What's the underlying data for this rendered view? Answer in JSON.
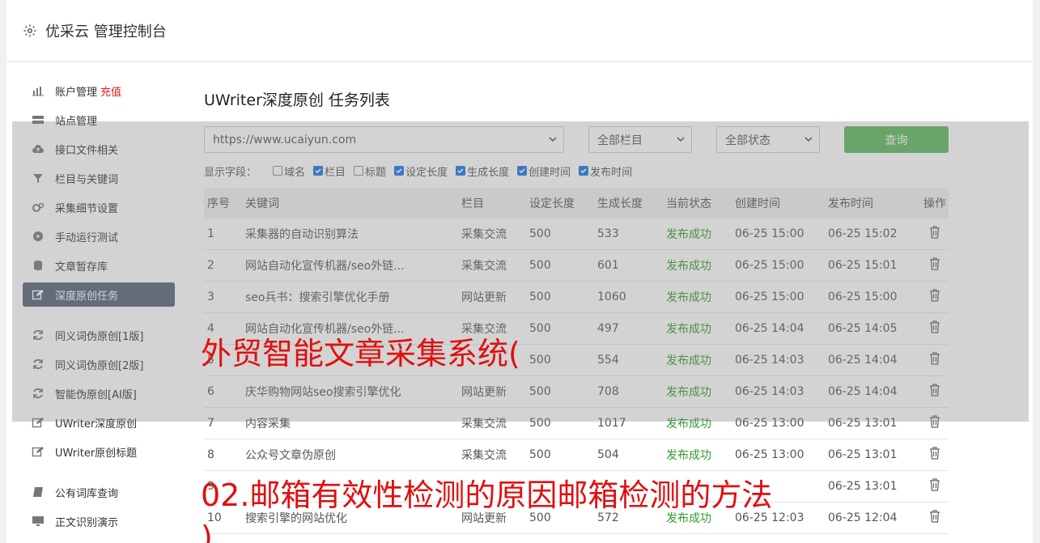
{
  "header": {
    "title": "优采云 管理控制台"
  },
  "sidebar": {
    "items": [
      {
        "label": "账户管理",
        "badge": "充值",
        "icon": "bar-chart-icon"
      },
      {
        "label": "站点管理",
        "icon": "server-icon"
      },
      {
        "label": "接口文件相关",
        "icon": "cloud-upload-icon"
      },
      {
        "label": "栏目与关键词",
        "icon": "filter-icon"
      },
      {
        "label": "采集细节设置",
        "icon": "cogs-icon"
      },
      {
        "label": "手动运行测试",
        "icon": "play-circle-icon"
      },
      {
        "label": "文章暂存库",
        "icon": "database-icon"
      },
      {
        "label": "深度原创任务",
        "icon": "edit-icon",
        "active": true
      },
      {
        "label": "同义词伪原创[1版]",
        "icon": "refresh-icon"
      },
      {
        "label": "同义词伪原创[2版]",
        "icon": "refresh-icon"
      },
      {
        "label": "智能伪原创[AI版]",
        "icon": "refresh-icon"
      },
      {
        "label": "UWriter深度原创",
        "icon": "edit-icon"
      },
      {
        "label": "UWriter原创标题",
        "icon": "edit-icon"
      },
      {
        "label": "公有词库查询",
        "icon": "book-icon"
      },
      {
        "label": "正文识别演示",
        "icon": "monitor-icon"
      }
    ]
  },
  "main": {
    "title": "UWriter深度原创 任务列表",
    "filters": {
      "site": "https://www.ucaiyun.com",
      "column": "全部栏目",
      "status": "全部状态",
      "query_label": "查询"
    },
    "fields": {
      "label": "显示字段：",
      "items": [
        {
          "label": "域名",
          "checked": false
        },
        {
          "label": "栏目",
          "checked": true
        },
        {
          "label": "标题",
          "checked": false
        },
        {
          "label": "设定长度",
          "checked": true
        },
        {
          "label": "生成长度",
          "checked": true
        },
        {
          "label": "创建时间",
          "checked": true
        },
        {
          "label": "发布时间",
          "checked": true
        }
      ]
    },
    "table": {
      "headers": [
        "序号",
        "关键词",
        "栏目",
        "设定长度",
        "生成长度",
        "当前状态",
        "创建时间",
        "发布时间",
        "操作"
      ],
      "rows": [
        [
          "1",
          "采集器的自动识别算法",
          "采集交流",
          "500",
          "533",
          "发布成功",
          "06-25 15:00",
          "06-25 15:02"
        ],
        [
          "2",
          "网站自动化宣传机器/seo外链...",
          "采集交流",
          "500",
          "601",
          "发布成功",
          "06-25 15:00",
          "06-25 15:01"
        ],
        [
          "3",
          "seo兵书：搜索引擎优化手册",
          "网站更新",
          "500",
          "1060",
          "发布成功",
          "06-25 15:00",
          "06-25 15:00"
        ],
        [
          "4",
          "网站自动化宣传机器/seo外链...",
          "采集交流",
          "500",
          "497",
          "发布成功",
          "06-25 14:04",
          "06-25 14:05"
        ],
        [
          "5",
          "",
          "",
          "500",
          "554",
          "发布成功",
          "06-25 14:03",
          "06-25 14:04"
        ],
        [
          "6",
          "庆华购物网站seo搜索引擎优化",
          "网站更新",
          "500",
          "708",
          "发布成功",
          "06-25 14:03",
          "06-25 14:04"
        ],
        [
          "7",
          "内容采集",
          "采集交流",
          "500",
          "1017",
          "发布成功",
          "06-25 13:00",
          "06-25 13:01"
        ],
        [
          "8",
          "公众号文章伪原创",
          "采集交流",
          "500",
          "504",
          "发布成功",
          "06-25 13:00",
          "06-25 13:01"
        ],
        [
          "9",
          "",
          "",
          "",
          "",
          "",
          "",
          "06-25 13:01"
        ],
        [
          "10",
          "搜索引擎的网站优化",
          "网站更新",
          "500",
          "572",
          "发布成功",
          "06-25 12:03",
          "06-25 12:04"
        ]
      ]
    }
  },
  "overlay": {
    "line1": "外贸智能文章采集系统(",
    "line2": "02.邮箱有效性检测的原因邮箱检测的方法",
    "line3": ")"
  },
  "colors": {
    "active_nav": "#566175",
    "query_button": "#5cb85c",
    "status_ok": "#2e9b2e",
    "overlay_text": "#e01010"
  }
}
